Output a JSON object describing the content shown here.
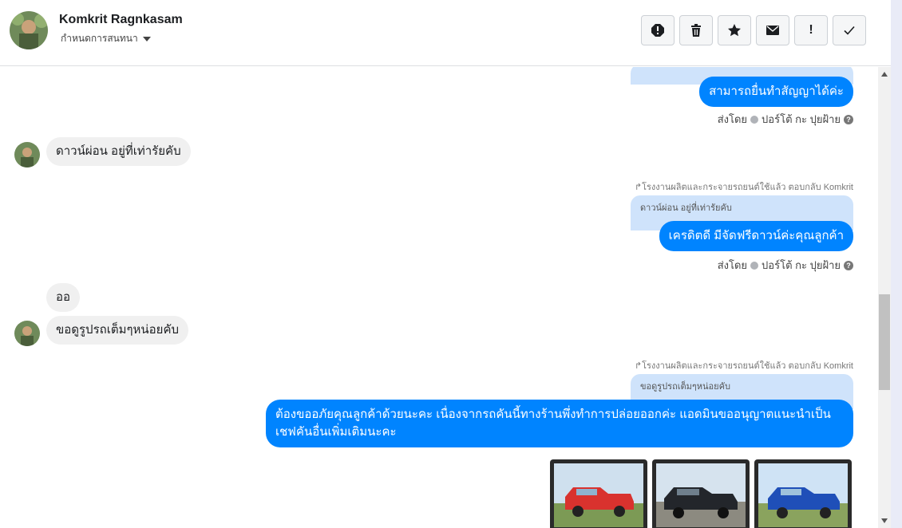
{
  "header": {
    "contact_name": "Komkrit Ragnkasam",
    "assign_label": "กำหนดการสนทนา",
    "toolbar": [
      {
        "name": "report-spam-icon"
      },
      {
        "name": "trash-icon"
      },
      {
        "name": "star-icon"
      },
      {
        "name": "mail-icon"
      },
      {
        "name": "exclamation-icon",
        "glyph": "!"
      },
      {
        "name": "checkmark-icon"
      }
    ]
  },
  "messages": {
    "m1_text": "สามารถยื่นทำสัญญาได้ค่ะ",
    "m1_sent_by": "ส่งโดย",
    "m1_sender": "ปอร์โต้ กะ ปุยฝ้าย",
    "m2_text": "ดาวน์ผ่อน อยู่ที่เท่ารัยคับ",
    "m3_replied_to": "โรงงานผลิตและกระจายรถยนต์ใช้แล้ว ตอบกลับ Komkrit",
    "m3_quote": "ดาวน์ผ่อน อยู่ที่เท่ารัยคับ",
    "m3_text": "เครดิตดี มีจัดฟรีดาวน์ค่ะคุณลูกค้า",
    "m3_sent_by": "ส่งโดย",
    "m3_sender": "ปอร์โต้ กะ ปุยฝ้าย",
    "m4_text": "ออ",
    "m5_text": "ขอดูรูปรถเต็มๆหน่อยคับ",
    "m6_replied_to": "โรงงานผลิตและกระจายรถยนต์ใช้แล้ว ตอบกลับ Komkrit",
    "m6_quote": "ขอดูรูปรถเต็มๆหน่อยคับ",
    "m6_text": "ต้องขออภัยคุณลูกค้าด้วยนะคะ เนื่องจากรถคันนี้ทางร้านพึ่งทำการปล่อยออกค่ะ แอดมินขออนุญาตแนะนำเป็นเชฟคันอื่นเพิ่มเติมนะคะ"
  },
  "photos": [
    {
      "name": "red-pickup-photo",
      "color": "#d9322e"
    },
    {
      "name": "black-pickup-photo",
      "color": "#23262b"
    },
    {
      "name": "blue-pickup-photo",
      "color": "#1f4fb8"
    }
  ],
  "colors": {
    "accent": "#0084ff",
    "incoming_bubble": "#f0f0f0",
    "quote_bg": "#cfe3fb"
  }
}
